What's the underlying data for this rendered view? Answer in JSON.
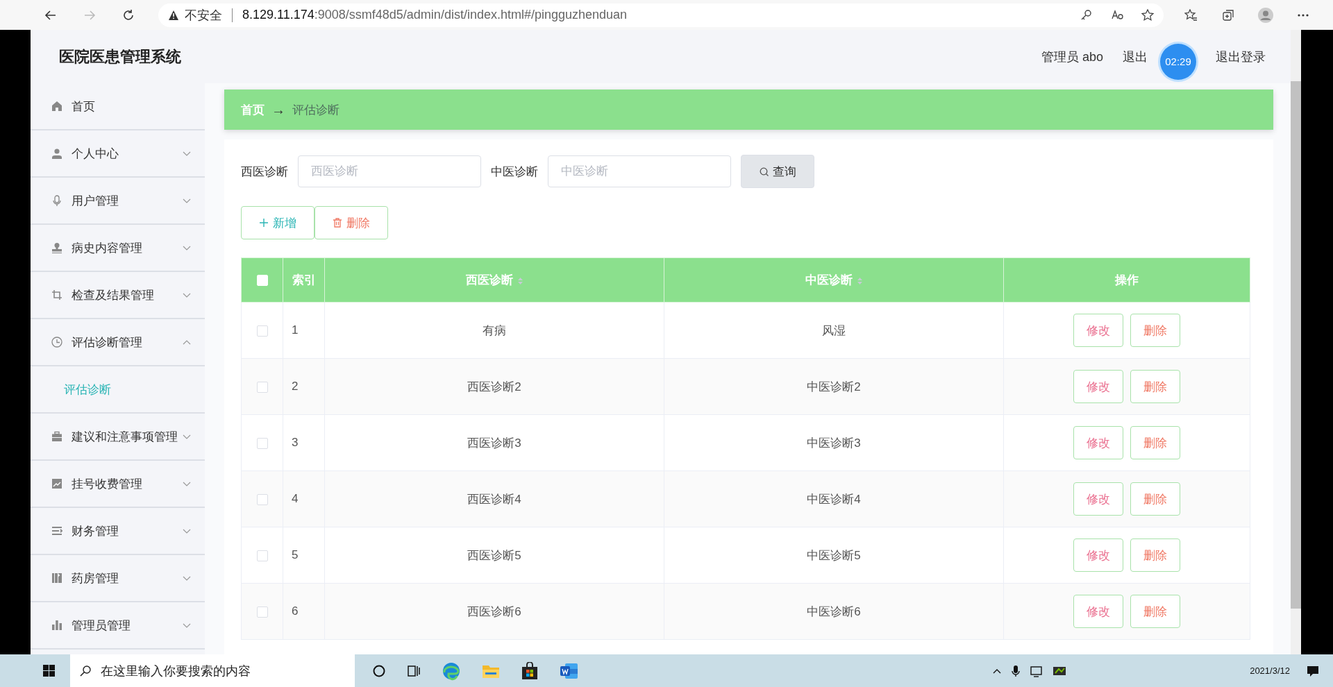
{
  "browser": {
    "security": "不安全",
    "url_host": "8.129.11.174",
    "url_rest": ":9008/ssmf48d5/admin/dist/index.html#/pingguzhenduan"
  },
  "header": {
    "title": "医院医患管理系统",
    "user": "管理员 abo",
    "links": [
      "退出",
      "退出登录"
    ],
    "timer_badge": "02:29"
  },
  "sidebar": {
    "items": [
      {
        "label": "首页",
        "kind": "link"
      },
      {
        "label": "个人中心",
        "kind": "menu",
        "expanded": false
      },
      {
        "label": "用户管理",
        "kind": "menu",
        "expanded": false
      },
      {
        "label": "病史内容管理",
        "kind": "menu",
        "expanded": false
      },
      {
        "label": "检查及结果管理",
        "kind": "menu",
        "expanded": false
      },
      {
        "label": "评估诊断管理",
        "kind": "menu",
        "expanded": true,
        "children": [
          {
            "label": "评估诊断",
            "selected": true
          }
        ]
      },
      {
        "label": "建议和注意事项管理",
        "kind": "menu",
        "expanded": false
      },
      {
        "label": "挂号收费管理",
        "kind": "menu",
        "expanded": false
      },
      {
        "label": "财务管理",
        "kind": "menu",
        "expanded": false
      },
      {
        "label": "药房管理",
        "kind": "menu",
        "expanded": false
      },
      {
        "label": "管理员管理",
        "kind": "menu",
        "expanded": false
      }
    ]
  },
  "breadcrumb": {
    "items": [
      "首页",
      "评估诊断"
    ],
    "separator": "→"
  },
  "search": {
    "fields": [
      {
        "label": "西医诊断",
        "placeholder": "西医诊断"
      },
      {
        "label": "中医诊断",
        "placeholder": "中医诊断"
      }
    ],
    "button": "查询"
  },
  "actions": [
    {
      "kind": "add",
      "label": "新增"
    },
    {
      "kind": "delete",
      "label": "删除"
    }
  ],
  "table": {
    "select_all_checked": false,
    "columns": [
      {
        "label": "索引",
        "sortable": false
      },
      {
        "label": "西医诊断",
        "sortable": true
      },
      {
        "label": "中医诊断",
        "sortable": true
      },
      {
        "label": "操作",
        "sortable": false
      }
    ],
    "rows": [
      {
        "checked": false,
        "index": "1",
        "western": "有病",
        "chinese": "风湿",
        "actions": [
          "修改",
          "删除"
        ]
      },
      {
        "checked": false,
        "index": "2",
        "western": "西医诊断2",
        "chinese": "中医诊断2",
        "actions": [
          "修改",
          "删除"
        ]
      },
      {
        "checked": false,
        "index": "3",
        "western": "西医诊断3",
        "chinese": "中医诊断3",
        "actions": [
          "修改",
          "删除"
        ]
      },
      {
        "checked": false,
        "index": "4",
        "western": "西医诊断4",
        "chinese": "中医诊断4",
        "actions": [
          "修改",
          "删除"
        ]
      },
      {
        "checked": false,
        "index": "5",
        "western": "西医诊断5",
        "chinese": "中医诊断5",
        "actions": [
          "修改",
          "删除"
        ]
      },
      {
        "checked": false,
        "index": "6",
        "western": "西医诊断6",
        "chinese": "中医诊断6",
        "actions": [
          "修改",
          "删除"
        ]
      }
    ]
  },
  "taskbar": {
    "search_placeholder": "在这里输入你要搜索的内容",
    "date": "2021/3/12"
  }
}
